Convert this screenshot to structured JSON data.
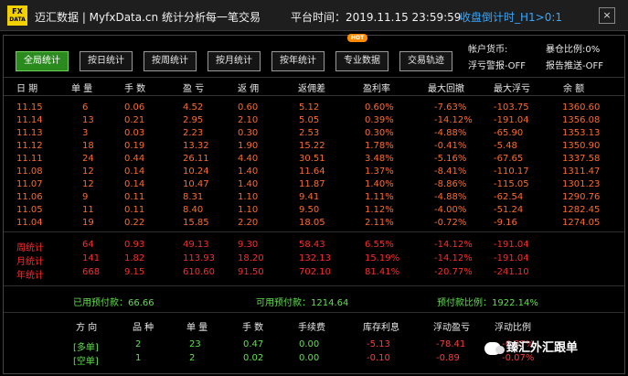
{
  "titlebar": {
    "logo_line1": "FX",
    "logo_line2": "DATA",
    "title": "迈汇数据 | MyfxData.cn  统计分析每一笔交易",
    "platform_time": "平台时间：2019.11.15 23:59:59",
    "countdown": "收盘倒计时_H1>0:1",
    "close": "×"
  },
  "tabs": [
    {
      "label": "全局统计",
      "active": true
    },
    {
      "label": "按日统计",
      "active": false
    },
    {
      "label": "按周统计",
      "active": false
    },
    {
      "label": "按月统计",
      "active": false
    },
    {
      "label": "按年统计",
      "active": false
    },
    {
      "label": "专业数据",
      "active": false,
      "badge": "HOT"
    },
    {
      "label": "交易轨迹",
      "active": false
    }
  ],
  "account": {
    "currency": "帐户货币:",
    "profit_ratio": "暴仓比例:0%",
    "loss_alert": "浮亏警报-OFF",
    "report_push": "报告推送-OFF"
  },
  "table": {
    "headers": [
      "日 期",
      "单 量",
      "手 数",
      "盈 亏",
      "返 佣",
      "返佣差",
      "盈利率",
      "最大回撤",
      "最大浮亏",
      "余 额"
    ],
    "rows": [
      [
        "11.15",
        "6",
        "0.06",
        "4.52",
        "0.60",
        "5.12",
        "0.60%",
        "-7.63%",
        "-103.75",
        "1360.60"
      ],
      [
        "11.14",
        "13",
        "0.21",
        "2.95",
        "2.10",
        "5.05",
        "0.39%",
        "-14.12%",
        "-191.04",
        "1356.08"
      ],
      [
        "11.13",
        "3",
        "0.03",
        "2.23",
        "0.30",
        "2.53",
        "0.30%",
        "-4.88%",
        "-65.90",
        "1353.13"
      ],
      [
        "11.12",
        "18",
        "0.19",
        "13.32",
        "1.90",
        "15.22",
        "1.78%",
        "-0.41%",
        "-5.48",
        "1350.90"
      ],
      [
        "11.11",
        "24",
        "0.44",
        "26.11",
        "4.40",
        "30.51",
        "3.48%",
        "-5.16%",
        "-67.65",
        "1337.58"
      ],
      [
        "11.08",
        "12",
        "0.14",
        "10.24",
        "1.40",
        "11.64",
        "1.37%",
        "-8.41%",
        "-110.17",
        "1311.47"
      ],
      [
        "11.07",
        "12",
        "0.14",
        "10.47",
        "1.40",
        "11.87",
        "1.40%",
        "-8.86%",
        "-115.05",
        "1301.23"
      ],
      [
        "11.06",
        "9",
        "0.11",
        "8.31",
        "1.10",
        "9.41",
        "1.11%",
        "-4.88%",
        "-62.54",
        "1290.76"
      ],
      [
        "11.05",
        "11",
        "0.11",
        "8.40",
        "1.10",
        "9.50",
        "1.12%",
        "-4.00%",
        "-51.24",
        "1282.45"
      ],
      [
        "11.04",
        "19",
        "0.22",
        "15.85",
        "2.20",
        "18.05",
        "2.11%",
        "-0.72%",
        "-9.16",
        "1274.05"
      ]
    ],
    "summary": [
      [
        "周统计",
        "64",
        "0.93",
        "49.13",
        "9.30",
        "58.43",
        "6.55%",
        "-14.12%",
        "-191.04"
      ],
      [
        "月统计",
        "141",
        "1.82",
        "113.93",
        "18.20",
        "132.13",
        "15.19%",
        "-14.12%",
        "-191.04"
      ],
      [
        "年统计",
        "668",
        "9.15",
        "610.60",
        "91.50",
        "702.10",
        "81.41%",
        "-20.77%",
        "-241.10"
      ]
    ]
  },
  "prepay": {
    "used": "已用预付款：66.66",
    "available": "可用预付款：1214.64",
    "ratio": "预付款比例：1922.14%"
  },
  "positions": {
    "headers": [
      "方 向",
      "品 种",
      "单 量",
      "手 数",
      "手续费",
      "库存利息",
      "浮动盈亏",
      "浮动比例"
    ],
    "rows": [
      [
        "[多单]",
        "2",
        "23",
        "0.47",
        "0.00",
        "-5.13",
        "-78.41",
        "-6.07%"
      ],
      [
        "[空单]",
        "1",
        "2",
        "0.02",
        "0.00",
        "-0.10",
        "-0.89",
        "-0.07%"
      ]
    ]
  },
  "watermark": "臻汇外汇跟单"
}
